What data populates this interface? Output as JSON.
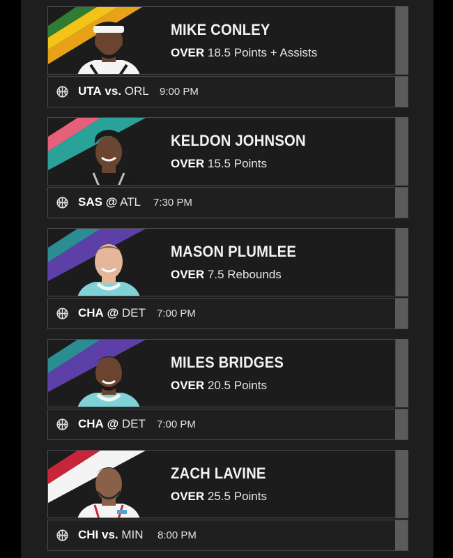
{
  "cards": [
    {
      "player": "MIKE CONLEY",
      "direction": "OVER",
      "line": "18.5 Points + Assists",
      "team1": "UTA",
      "separator": "vs.",
      "team2": "ORL",
      "time": "9:00 PM",
      "stripe_colors": [
        "#2e7d32",
        "#f2c318",
        "#e8a21a"
      ],
      "jersey_color": "#f4f4f4",
      "headband": true,
      "icon": "basketball-icon"
    },
    {
      "player": "KELDON JOHNSON",
      "direction": "OVER",
      "line": "15.5 Points",
      "team1": "SAS",
      "separator": "@",
      "team2": "ATL",
      "time": "7:30 PM",
      "stripe_colors": [
        "#e6607c",
        "#2aa199",
        "#1c1c1c"
      ],
      "jersey_color": "#1a1a1a",
      "icon": "basketball-icon"
    },
    {
      "player": "MASON PLUMLEE",
      "direction": "OVER",
      "line": "7.5 Rebounds",
      "team1": "CHA",
      "separator": "@",
      "team2": "DET",
      "time": "7:00 PM",
      "stripe_colors": [
        "#2c8c93",
        "#5d3fa8",
        "#1c1c1c"
      ],
      "jersey_color": "#7fd3d6",
      "icon": "basketball-icon"
    },
    {
      "player": "MILES BRIDGES",
      "direction": "OVER",
      "line": "20.5 Points",
      "team1": "CHA",
      "separator": "@",
      "team2": "DET",
      "time": "7:00 PM",
      "stripe_colors": [
        "#2c8c93",
        "#5d3fa8",
        "#1c1c1c"
      ],
      "jersey_color": "#7fd3d6",
      "icon": "basketball-icon"
    },
    {
      "player": "ZACH LAVINE",
      "direction": "OVER",
      "line": "25.5 Points",
      "team1": "CHI",
      "separator": "vs.",
      "team2": "MIN",
      "time": "8:00 PM",
      "stripe_colors": [
        "#c8243a",
        "#f4f4f4",
        "#1c1c1c"
      ],
      "jersey_color": "#f4f4f4",
      "icon": "basketball-icon"
    }
  ]
}
